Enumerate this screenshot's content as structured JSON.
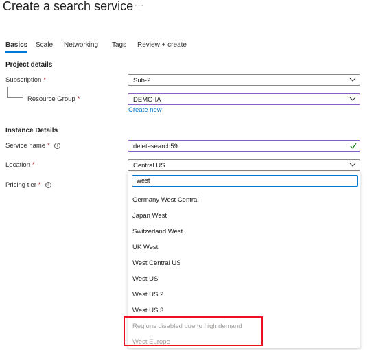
{
  "header": {
    "title": "Create a search service",
    "more": "···"
  },
  "tabs": [
    "Basics",
    "Scale",
    "Networking",
    "Tags",
    "Review + create"
  ],
  "sections": {
    "project": "Project details",
    "instance": "Instance Details"
  },
  "form": {
    "subscription": {
      "label": "Subscription",
      "required": "*",
      "value": "Sub-2"
    },
    "resource_group": {
      "label": "Resource Group",
      "required": "*",
      "value": "DEMO-IA",
      "create_new": "Create new"
    },
    "service_name": {
      "label": "Service name",
      "required": "*",
      "value": "deletesearch59"
    },
    "location": {
      "label": "Location",
      "required": "*",
      "value": "Central US"
    },
    "pricing_tier": {
      "label": "Pricing tier",
      "required": "*"
    }
  },
  "location_dropdown": {
    "filter_value": "west",
    "options": [
      "Germany West Central",
      "Japan West",
      "Switzerland West",
      "UK West",
      "West Central US",
      "West US",
      "West US 2",
      "West US 3"
    ],
    "disabled_group_label": "Regions disabled due to high demand",
    "disabled_options": [
      "West Europe"
    ]
  },
  "colors": {
    "accent": "#0078d4",
    "focus_border": "#8661c5",
    "success": "#107c10",
    "required": "#a4262c",
    "highlight": "#e81123"
  },
  "icons": [
    "info-icon",
    "chevron-down-icon",
    "check-icon"
  ]
}
